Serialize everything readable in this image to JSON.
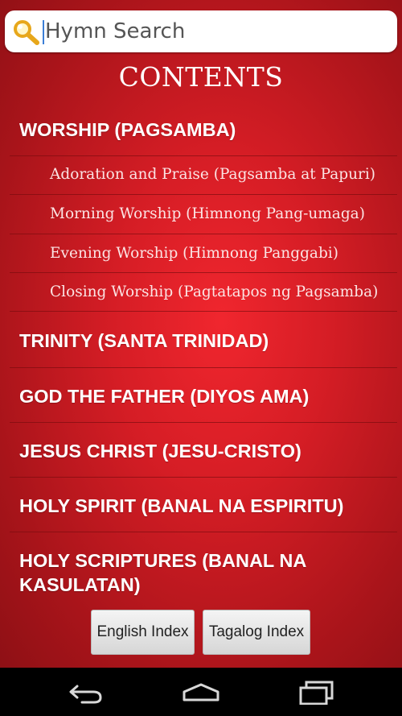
{
  "search": {
    "placeholder": "Hymn Search",
    "icon": "search-icon"
  },
  "title": "CONTENTS",
  "sections": [
    {
      "label": "WORSHIP (PAGSAMBA)",
      "items": [
        "Adoration and Praise (Pagsamba at Papuri)",
        "Morning Worship (Himnong Pang-umaga)",
        "Evening Worship (Himnong Panggabi)",
        "Closing Worship (Pagtatapos ng Pagsamba)"
      ]
    },
    {
      "label": "TRINITY (SANTA TRINIDAD)"
    },
    {
      "label": "GOD THE FATHER (DIYOS AMA)"
    },
    {
      "label": "JESUS CHRIST (JESU-CRISTO)"
    },
    {
      "label": "HOLY SPIRIT (BANAL NA ESPIRITU)"
    },
    {
      "label": "HOLY SCRIPTURES (BANAL NA KASULATAN)"
    }
  ],
  "buttons": {
    "english": "English Index",
    "tagalog": "Tagalog Index"
  },
  "navbar": {
    "back_icon": "back-icon",
    "home_icon": "home-icon",
    "recents_icon": "recent-apps-icon"
  },
  "colors": {
    "background": "#d51d25",
    "text": "#ffffff"
  }
}
